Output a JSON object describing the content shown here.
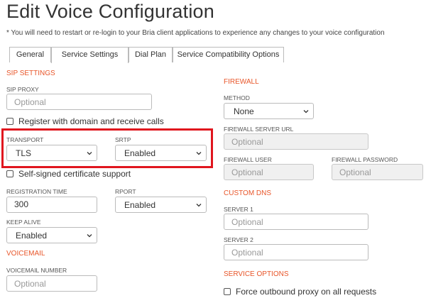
{
  "page": {
    "title": "Edit Voice Configuration",
    "note": "* You will need to restart or re-login to your Bria client applications to experience any changes to your voice configuration"
  },
  "tabs": [
    {
      "label": "General",
      "active": false
    },
    {
      "label": "Service Settings",
      "active": true
    },
    {
      "label": "Dial Plan",
      "active": false
    },
    {
      "label": "Service Compatibility Options",
      "active": false
    }
  ],
  "sip": {
    "heading": "SIP SETTINGS",
    "proxy_label": "SIP PROXY",
    "proxy_placeholder": "Optional",
    "register_label": "Register with domain and receive calls",
    "register_checked": false,
    "transport_label": "TRANSPORT",
    "transport_value": "TLS",
    "srtp_label": "SRTP",
    "srtp_value": "Enabled",
    "selfsigned_label": "Self-signed certificate support",
    "selfsigned_checked": false,
    "regtime_label": "REGISTRATION TIME",
    "regtime_value": "300",
    "rport_label": "RPORT",
    "rport_value": "Enabled",
    "keepalive_label": "KEEP ALIVE",
    "keepalive_value": "Enabled"
  },
  "voicemail": {
    "heading": "VOICEMAIL",
    "number_label": "VOICEMAIL NUMBER",
    "number_placeholder": "Optional"
  },
  "firewall": {
    "heading": "FIREWALL",
    "method_label": "METHOD",
    "method_value": "None",
    "server_url_label": "FIREWALL SERVER URL",
    "server_url_placeholder": "Optional",
    "user_label": "FIREWALL USER",
    "user_placeholder": "Optional",
    "password_label": "FIREWALL PASSWORD",
    "password_placeholder": "Optional"
  },
  "dns": {
    "heading": "CUSTOM DNS",
    "server1_label": "SERVER 1",
    "server1_placeholder": "Optional",
    "server2_label": "SERVER 2",
    "server2_placeholder": "Optional"
  },
  "service_options": {
    "heading": "SERVICE OPTIONS",
    "force_proxy_label": "Force outbound proxy on all requests",
    "force_proxy_checked": false
  },
  "colors": {
    "section_heading": "#e8562a",
    "highlight_box": "#e0161e",
    "disabled_field": "#f0f0f0"
  }
}
